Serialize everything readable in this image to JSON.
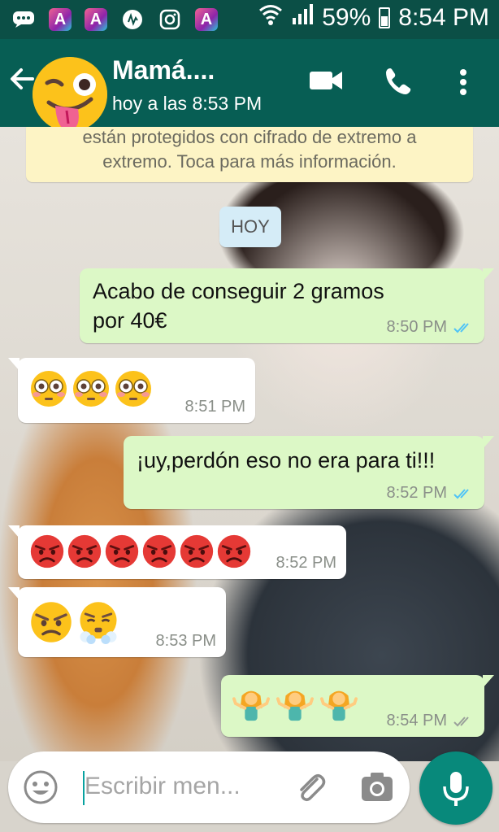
{
  "status_bar": {
    "battery": "59%",
    "time": "8:54 PM",
    "icons": [
      "chat-icon",
      "app-icon",
      "app-icon",
      "music-icon",
      "instagram-icon",
      "app-icon",
      "wifi-icon",
      "signal-icon",
      "battery-icon"
    ]
  },
  "header": {
    "contact_name": "Mamá....",
    "last_seen": "hoy a las 8:53 PM",
    "avatar": "winking-tongue-emoji"
  },
  "notice": {
    "line1": "están protegidos con cifrado de extremo a",
    "line2": "extremo. Toca para más información."
  },
  "day_chip": "HOY",
  "messages": [
    {
      "direction": "out",
      "line1": "Acabo de conseguir 2 gramos",
      "line2": "por 40€",
      "time": "8:50 PM",
      "read": true
    },
    {
      "direction": "in",
      "emojis": [
        "flushed-face",
        "flushed-face",
        "flushed-face"
      ],
      "time": "8:51 PM"
    },
    {
      "direction": "out",
      "text": "¡uy,perdón eso no era para ti!!!",
      "time": "8:52 PM",
      "read": true
    },
    {
      "direction": "in",
      "emojis": [
        "pouting-face",
        "pouting-face",
        "pouting-face",
        "pouting-face",
        "pouting-face",
        "pouting-face"
      ],
      "time": "8:52 PM"
    },
    {
      "direction": "in",
      "emojis": [
        "angry-face",
        "face-with-steam"
      ],
      "time": "8:53 PM"
    },
    {
      "direction": "out",
      "emojis": [
        "person-shrugging",
        "person-shrugging",
        "person-shrugging"
      ],
      "time": "8:54 PM",
      "read": false
    }
  ],
  "input": {
    "placeholder": "Escribir men..."
  },
  "colors": {
    "header": "#075e54",
    "status_bar": "#0b4f46",
    "outgoing_bubble": "#dcf8c6",
    "incoming_bubble": "#ffffff",
    "read_ticks": "#4fc3f7",
    "mic_button": "#08897b"
  }
}
